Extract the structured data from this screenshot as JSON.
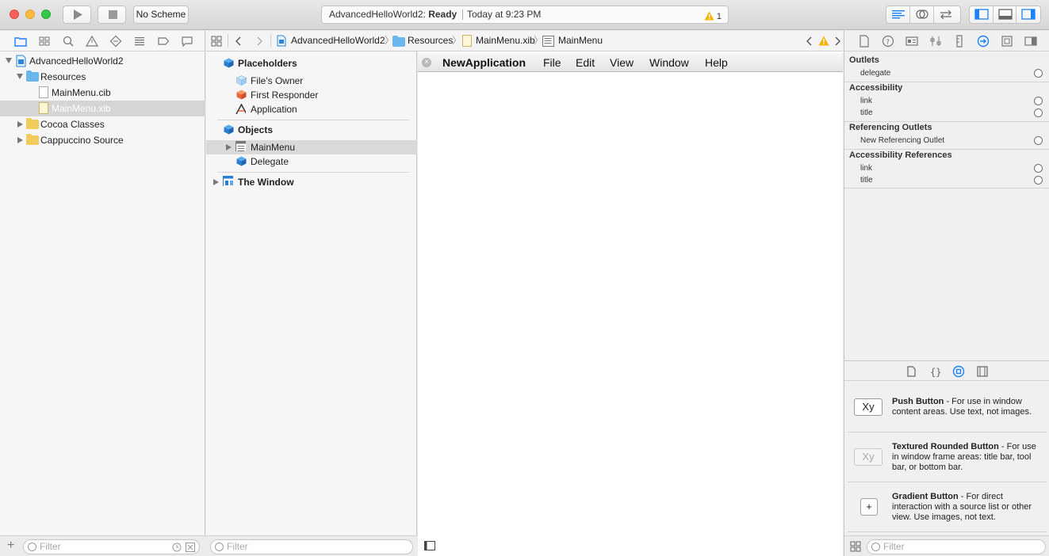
{
  "toolbar": {
    "scheme_label": "No Scheme",
    "activity_project": "AdvancedHelloWorld2:",
    "activity_status": "Ready",
    "activity_time": "Today at 9:23 PM",
    "warning_count": "1"
  },
  "navigator": {
    "items": [
      {
        "label": "AdvancedHelloWorld2",
        "kind": "project-icon"
      },
      {
        "label": "Resources",
        "kind": "folder-icon"
      },
      {
        "label": "MainMenu.cib",
        "kind": "file-icon"
      },
      {
        "label": "MainMenu.xib",
        "kind": "xib-file-icon"
      },
      {
        "label": "Cocoa Classes",
        "kind": "folder-icon"
      },
      {
        "label": "Cappuccino Source",
        "kind": "folder-icon"
      }
    ],
    "filter_placeholder": "Filter"
  },
  "jumpbar": {
    "crumbs": [
      "AdvancedHelloWorld2",
      "Resources",
      "MainMenu.xib",
      "MainMenu"
    ]
  },
  "outline": {
    "placeholders_label": "Placeholders",
    "placeholders": [
      "File's Owner",
      "First Responder",
      "Application"
    ],
    "objects_label": "Objects",
    "objects": [
      "MainMenu",
      "Delegate"
    ],
    "window_label": "The Window",
    "filter_placeholder": "Filter"
  },
  "canvas": {
    "menu": [
      "NewApplication",
      "File",
      "Edit",
      "View",
      "Window",
      "Help"
    ]
  },
  "inspector": {
    "sections": [
      {
        "title": "Outlets",
        "items": [
          "delegate"
        ]
      },
      {
        "title": "Accessibility",
        "items": [
          "link",
          "title"
        ]
      },
      {
        "title": "Referencing Outlets",
        "items": [
          "New Referencing Outlet"
        ]
      },
      {
        "title": "Accessibility References",
        "items": [
          "link",
          "title"
        ]
      }
    ]
  },
  "library": {
    "items": [
      {
        "title": "Push Button",
        "desc": " - For use in window content areas. Use text, not images.",
        "thumb": "Xy"
      },
      {
        "title": "Textured Rounded Button",
        "desc": " - For use in window frame areas: title bar, tool bar, or bottom bar.",
        "thumb": "Xy"
      },
      {
        "title": "Gradient Button",
        "desc": " - For direct interaction with a source list or other view. Use images, not text.",
        "thumb": "+"
      }
    ],
    "filter_placeholder": "Filter"
  },
  "colors": {
    "accent": "#1a82fb",
    "folder_blue": "#6ab7ee",
    "folder_yellow": "#f1cc5b",
    "warning": "#f5b400"
  }
}
